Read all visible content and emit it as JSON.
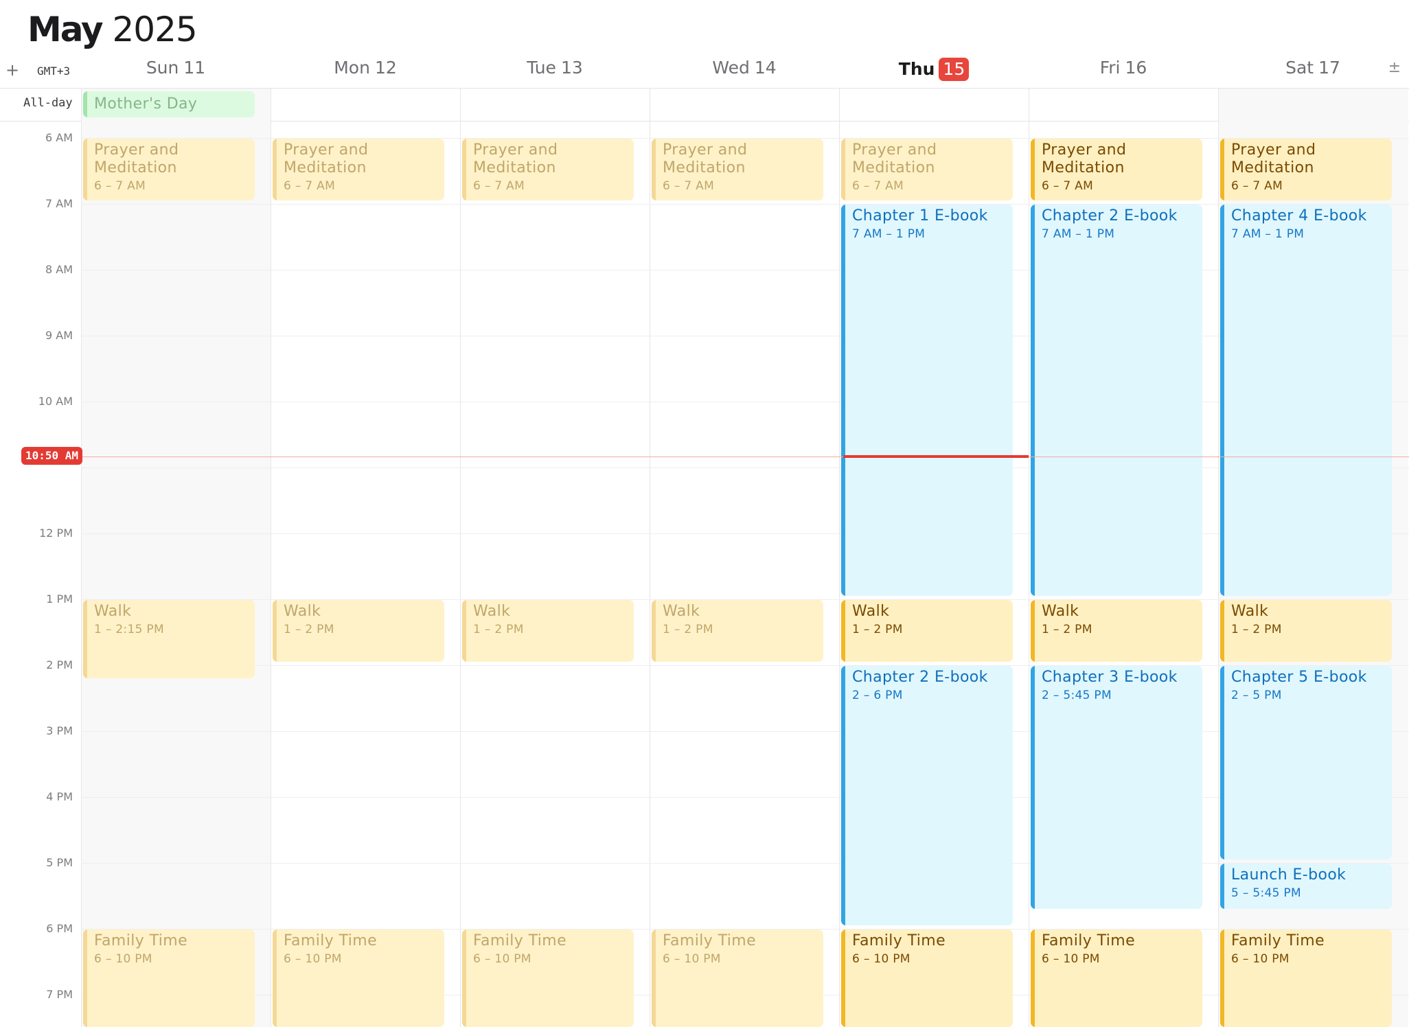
{
  "header": {
    "month": "May",
    "year": "2025",
    "add_symbol": "+",
    "timezone": "GMT+3",
    "zoom_symbol": "±"
  },
  "days": [
    {
      "name": "Sun",
      "num": "11"
    },
    {
      "name": "Mon",
      "num": "12"
    },
    {
      "name": "Tue",
      "num": "13"
    },
    {
      "name": "Wed",
      "num": "14"
    },
    {
      "name": "Thu",
      "num": "15",
      "today": true
    },
    {
      "name": "Fri",
      "num": "16"
    },
    {
      "name": "Sat",
      "num": "17"
    }
  ],
  "allday": {
    "label": "All-day",
    "events": [
      {
        "day": 0,
        "title": "Mother's Day",
        "color": "green"
      }
    ]
  },
  "time_labels": [
    "6 AM",
    "7 AM",
    "8 AM",
    "9 AM",
    "10 AM",
    "12 PM",
    "1 PM",
    "2 PM",
    "3 PM",
    "4 PM",
    "5 PM",
    "6 PM",
    "7 PM"
  ],
  "now": {
    "label": "10:50 AM",
    "hour": 10.833,
    "day": 4
  },
  "events": [
    {
      "day": 0,
      "title": "Prayer and Meditation",
      "time": "6 – 7 AM",
      "start": 6,
      "end": 7,
      "color": "yellow",
      "past": true
    },
    {
      "day": 1,
      "title": "Prayer and Meditation",
      "time": "6 – 7 AM",
      "start": 6,
      "end": 7,
      "color": "yellow",
      "past": true
    },
    {
      "day": 2,
      "title": "Prayer and Meditation",
      "time": "6 – 7 AM",
      "start": 6,
      "end": 7,
      "color": "yellow",
      "past": true
    },
    {
      "day": 3,
      "title": "Prayer and Meditation",
      "time": "6 – 7 AM",
      "start": 6,
      "end": 7,
      "color": "yellow",
      "past": true
    },
    {
      "day": 4,
      "title": "Prayer and Meditation",
      "time": "6 – 7 AM",
      "start": 6,
      "end": 7,
      "color": "yellow",
      "past": true
    },
    {
      "day": 5,
      "title": "Prayer and Meditation",
      "time": "6 – 7 AM",
      "start": 6,
      "end": 7,
      "color": "yellow",
      "past": false
    },
    {
      "day": 6,
      "title": "Prayer and Meditation",
      "time": "6 – 7 AM",
      "start": 6,
      "end": 7,
      "color": "yellow",
      "past": false
    },
    {
      "day": 4,
      "title": "Chapter 1 E-book",
      "time": "7 AM – 1 PM",
      "start": 7,
      "end": 13,
      "color": "blue",
      "past": false
    },
    {
      "day": 5,
      "title": "Chapter 2 E-book",
      "time": "7 AM – 1 PM",
      "start": 7,
      "end": 13,
      "color": "blue",
      "past": false
    },
    {
      "day": 6,
      "title": "Chapter 4 E-book",
      "time": "7 AM – 1 PM",
      "start": 7,
      "end": 13,
      "color": "blue",
      "past": false
    },
    {
      "day": 0,
      "title": "Walk",
      "time": "1 – 2:15 PM",
      "start": 13,
      "end": 14.25,
      "color": "yellow",
      "past": true
    },
    {
      "day": 1,
      "title": "Walk",
      "time": "1 – 2 PM",
      "start": 13,
      "end": 14,
      "color": "yellow",
      "past": true
    },
    {
      "day": 2,
      "title": "Walk",
      "time": "1 – 2 PM",
      "start": 13,
      "end": 14,
      "color": "yellow",
      "past": true
    },
    {
      "day": 3,
      "title": "Walk",
      "time": "1 – 2 PM",
      "start": 13,
      "end": 14,
      "color": "yellow",
      "past": true
    },
    {
      "day": 4,
      "title": "Walk",
      "time": "1 – 2 PM",
      "start": 13,
      "end": 14,
      "color": "yellow",
      "past": false
    },
    {
      "day": 5,
      "title": "Walk",
      "time": "1 – 2 PM",
      "start": 13,
      "end": 14,
      "color": "yellow",
      "past": false
    },
    {
      "day": 6,
      "title": "Walk",
      "time": "1 – 2 PM",
      "start": 13,
      "end": 14,
      "color": "yellow",
      "past": false
    },
    {
      "day": 4,
      "title": "Chapter 2 E-book",
      "time": "2 – 6 PM",
      "start": 14,
      "end": 18,
      "color": "blue",
      "past": false
    },
    {
      "day": 5,
      "title": "Chapter 3 E-book",
      "time": "2 – 5:45 PM",
      "start": 14,
      "end": 17.75,
      "color": "blue",
      "past": false
    },
    {
      "day": 6,
      "title": "Chapter 5 E-book",
      "time": "2 – 5 PM",
      "start": 14,
      "end": 17,
      "color": "blue",
      "past": false
    },
    {
      "day": 6,
      "title": "Launch E-book",
      "time": "5 – 5:45 PM",
      "start": 17,
      "end": 17.75,
      "color": "blue",
      "past": false
    },
    {
      "day": 0,
      "title": "Family Time",
      "time": "6 – 10 PM",
      "start": 18,
      "end": 22,
      "color": "yellow",
      "past": true
    },
    {
      "day": 1,
      "title": "Family Time",
      "time": "6 – 10 PM",
      "start": 18,
      "end": 22,
      "color": "yellow",
      "past": true
    },
    {
      "day": 2,
      "title": "Family Time",
      "time": "6 – 10 PM",
      "start": 18,
      "end": 22,
      "color": "yellow",
      "past": true
    },
    {
      "day": 3,
      "title": "Family Time",
      "time": "6 – 10 PM",
      "start": 18,
      "end": 22,
      "color": "yellow",
      "past": true
    },
    {
      "day": 4,
      "title": "Family Time",
      "time": "6 – 10 PM",
      "start": 18,
      "end": 22,
      "color": "yellow",
      "past": false
    },
    {
      "day": 5,
      "title": "Family Time",
      "time": "6 – 10 PM",
      "start": 18,
      "end": 22,
      "color": "yellow",
      "past": false
    },
    {
      "day": 6,
      "title": "Family Time",
      "time": "6 – 10 PM",
      "start": 18,
      "end": 22,
      "color": "yellow",
      "past": false
    }
  ]
}
